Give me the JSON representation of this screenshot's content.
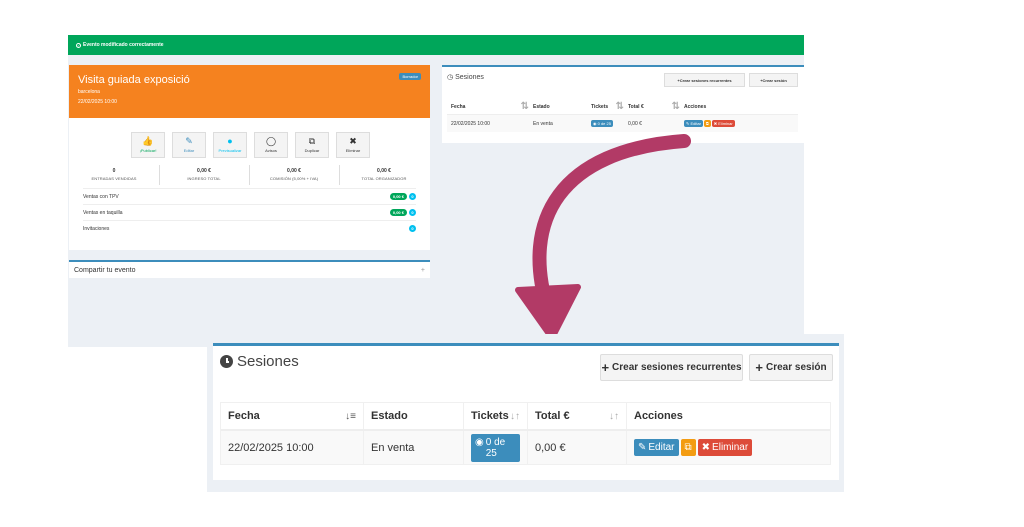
{
  "colors": {
    "success": "#00a65a",
    "event_header": "#f5821f",
    "primary": "#3c8dbc",
    "warning": "#f39c12",
    "danger": "#dd4b39",
    "info": "#00c0ef",
    "arrow": "#b23a66",
    "background": "#ecf0f5"
  },
  "alert": {
    "icon": "check-circle-icon",
    "text": "Evento modificado correctamente"
  },
  "event": {
    "title": "Visita guiada exposició",
    "city": "barcelona",
    "date": "22/02/2025 10:00",
    "status_badge": "Borrador",
    "actions": [
      {
        "icon": "thumbs-up-icon",
        "label": "¡Publicar!"
      },
      {
        "icon": "pencil-icon",
        "label": "Editar"
      },
      {
        "icon": "globe-icon",
        "label": "Previsualizar"
      },
      {
        "icon": "comment-icon",
        "label": "Avisos"
      },
      {
        "icon": "copy-icon",
        "label": "Duplicar"
      },
      {
        "icon": "close-icon",
        "label": "Eliminar"
      }
    ],
    "stats": [
      {
        "value": "0",
        "label": "ENTRADAS VENDIDAS"
      },
      {
        "value": "0,00 €",
        "label": "INGRESO TOTAL"
      },
      {
        "value": "0,00 €",
        "label": "COMISIÓN (5,00% + IVA)"
      },
      {
        "value": "0,00 €",
        "label": "TOTAL ORGANIZADOR"
      }
    ],
    "sales_rows": [
      {
        "label": "Ventas con TPV",
        "amount": "0,00 €",
        "count": "0"
      },
      {
        "label": "Ventas en taquilla",
        "amount": "0,00 €",
        "count": "0"
      },
      {
        "label": "Invitaciones",
        "amount": "",
        "count": "0"
      }
    ]
  },
  "share": {
    "label": "Compartir tu evento",
    "toggle": "+"
  },
  "sessions": {
    "icon": "clock-icon",
    "title": "Sesiones",
    "buttons": {
      "recurring": "Crear sesiones recurrentes",
      "create": "Crear sesión",
      "plus": "+"
    },
    "columns": [
      "Fecha",
      "Estado",
      "Tickets",
      "Total €",
      "Acciones"
    ],
    "rows": [
      {
        "date": "22/02/2025 10:00",
        "status": "En venta",
        "tickets": "0 de 25",
        "total": "0,00 €",
        "actions": {
          "edit": "Editar",
          "delete": "Eliminar"
        }
      }
    ]
  }
}
